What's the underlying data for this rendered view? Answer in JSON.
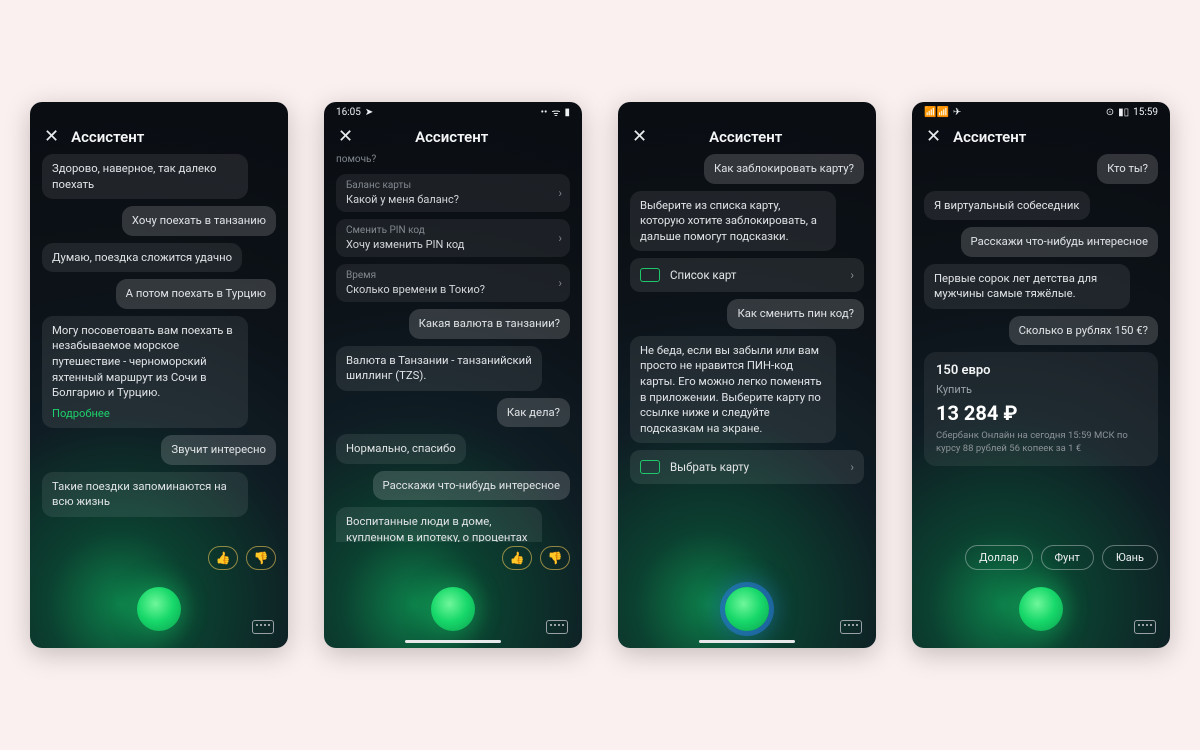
{
  "screens": [
    {
      "title": "Ассистент",
      "time": "",
      "messages": [
        {
          "role": "in",
          "text": "Здорово, наверное, так далеко поехать"
        },
        {
          "role": "out",
          "text": "Хочу поехать в танзанию"
        },
        {
          "role": "in",
          "text": "Думаю, поездка сложится удачно"
        },
        {
          "role": "out",
          "text": "А потом поехать в Турцию"
        },
        {
          "role": "in",
          "text": "Могу посоветовать вам поехать в незабываемое морское путешествие - черноморский яхтенный маршрут из Сочи в Болгарию и Турцию.",
          "more": "Подробнее"
        },
        {
          "role": "out",
          "text": "Звучит интересно"
        },
        {
          "role": "in",
          "text": "Такие поездки запоминаются на всю жизнь"
        }
      ],
      "feedback": true,
      "orb": "green"
    },
    {
      "title": "Ассистент",
      "time": "16:05",
      "status_right": "📶 📶 🔋",
      "prelabel": "помочь?",
      "suggestions": [
        {
          "label": "Баланс карты",
          "text": "Какой у меня баланс?"
        },
        {
          "label": "Сменить PIN код",
          "text": "Хочу изменить PIN код"
        },
        {
          "label": "Время",
          "text": "Сколько времени в Токио?"
        }
      ],
      "messages": [
        {
          "role": "out",
          "text": "Какая валюта в танзании?"
        },
        {
          "role": "in",
          "text": "Валюта в Танзании - танзанийский шиллинг (TZS)."
        },
        {
          "role": "out",
          "text": "Как дела?"
        },
        {
          "role": "in",
          "text": "Нормально, спасибо"
        },
        {
          "role": "out",
          "text": "Расскажи что-нибудь интересное"
        },
        {
          "role": "in",
          "text": "Воспитанные люди в доме, купленном в ипотеку, о процентах не говорят!"
        }
      ],
      "feedback": true,
      "orb": "green",
      "home_bar": true
    },
    {
      "title": "Ассистент",
      "messages_top": [
        {
          "role": "out",
          "text": "Как заблокировать карту?"
        },
        {
          "role": "in",
          "text": "Выберите из списка карту, которую хотите заблокировать, а дальше помогут подсказки."
        }
      ],
      "action1": "Список карт",
      "messages_mid": [
        {
          "role": "out",
          "text": "Как сменить пин код?"
        },
        {
          "role": "in",
          "text": "Не беда, если вы забыли или вам просто не нравится ПИН-код карты. Его можно легко поменять в приложении. Выберите карту по ссылке ниже и следуйте подсказкам на экране."
        }
      ],
      "action2": "Выбрать карту",
      "orb": "blue",
      "home_bar": true
    },
    {
      "title": "Ассистент",
      "time_right": "15:59",
      "status_left": "📶📶 ✈",
      "status_right_icons": "⊙ ▮▯",
      "messages": [
        {
          "role": "out",
          "text": "Кто ты?"
        },
        {
          "role": "in",
          "text": "Я виртуальный собеседник"
        },
        {
          "role": "out",
          "text": "Расскажи что-нибудь интересное"
        },
        {
          "role": "in",
          "text": "Первые сорок лет детства для мужчины самые тяжёлые."
        },
        {
          "role": "out",
          "text": "Сколько в рублях 150 €?"
        }
      ],
      "rate": {
        "top": "150 евро",
        "buy": "Купить",
        "big": "13 284 ₽",
        "note": "Сбербанк Онлайн на сегодня 15:59 МСК по курсу 88 рублей 56 копеек за 1 €"
      },
      "pills": [
        "Доллар",
        "Фунт",
        "Юань"
      ],
      "orb": "green"
    }
  ]
}
